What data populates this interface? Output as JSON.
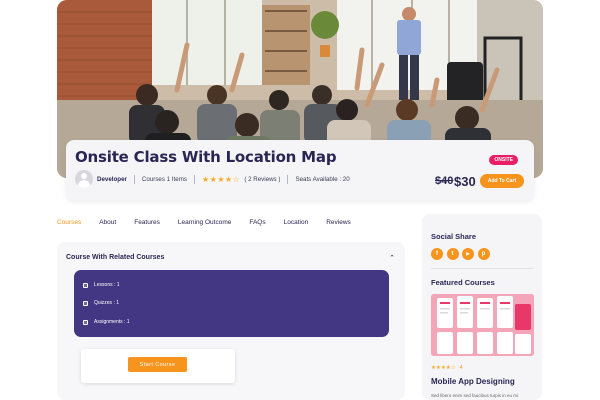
{
  "course": {
    "title": "Onsite Class With Location Map",
    "badge": "ONSITE",
    "author": "Developer",
    "items": "Courses 1 Items",
    "stars": "★★★★☆",
    "rating_value": 3.5,
    "reviews": "( 2 Reviews )",
    "seats": "Seats Available : 20",
    "old_price": "$40",
    "new_price": "$30",
    "cart_label": "Add To Cart"
  },
  "tabs": [
    {
      "label": "Courses",
      "active": true
    },
    {
      "label": "About"
    },
    {
      "label": "Features"
    },
    {
      "label": "Learning Outcome"
    },
    {
      "label": "FAQs"
    },
    {
      "label": "Location"
    },
    {
      "label": "Reviews"
    }
  ],
  "panel": {
    "title": "Course With Related Courses",
    "chevron": "⌃",
    "items": [
      "Lessons : 1",
      "Quizzes : 1",
      "Assignments : 1"
    ],
    "start_label": "Start Course"
  },
  "sidebar": {
    "social_title": "Social Share",
    "social_icons": [
      "facebook-icon",
      "twitter-icon",
      "youtube-icon",
      "pinterest-icon"
    ],
    "social_glyphs": [
      "f",
      "t",
      "▶",
      "p"
    ],
    "featured_title": "Featured Courses",
    "featured": {
      "stars": "★★★★☆",
      "rating": "4",
      "title": "Mobile App Designing",
      "desc": "Sed libero enim sed faucibus turpis in eu mi"
    }
  },
  "colors": {
    "accent": "#f7941d",
    "primary": "#433683",
    "badge": "#e91e63",
    "text": "#2a2553"
  }
}
